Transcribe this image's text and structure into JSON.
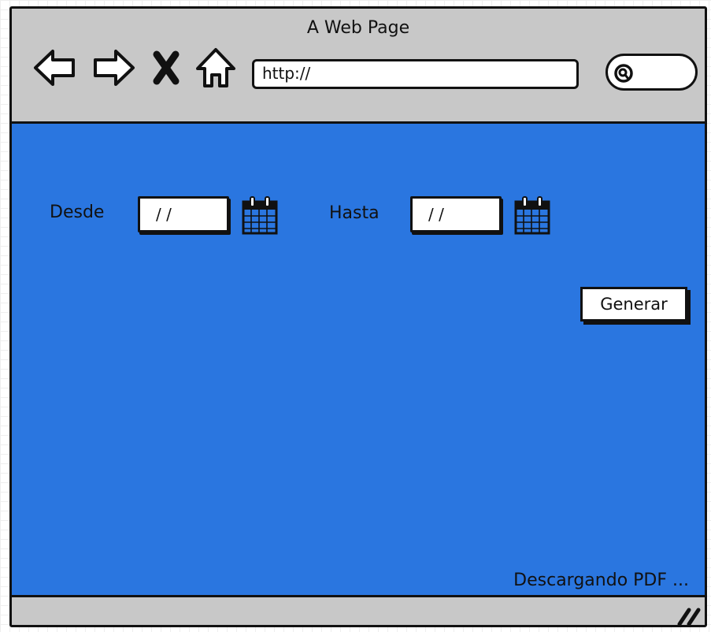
{
  "window": {
    "title": "A Web Page"
  },
  "toolbar": {
    "back_icon": "back-arrow-icon",
    "forward_icon": "forward-arrow-icon",
    "stop_icon": "close-icon",
    "home_icon": "home-icon",
    "url": "http://",
    "search_icon": "search-icon"
  },
  "form": {
    "from_label": "Desde",
    "from_value": "/ /",
    "to_label": "Hasta",
    "to_value": "/ /",
    "generate_label": "Generar",
    "status_text": "Descargando PDF ..."
  },
  "colors": {
    "content_bg": "#2a76e0",
    "chrome_bg": "#c8c8c8"
  }
}
